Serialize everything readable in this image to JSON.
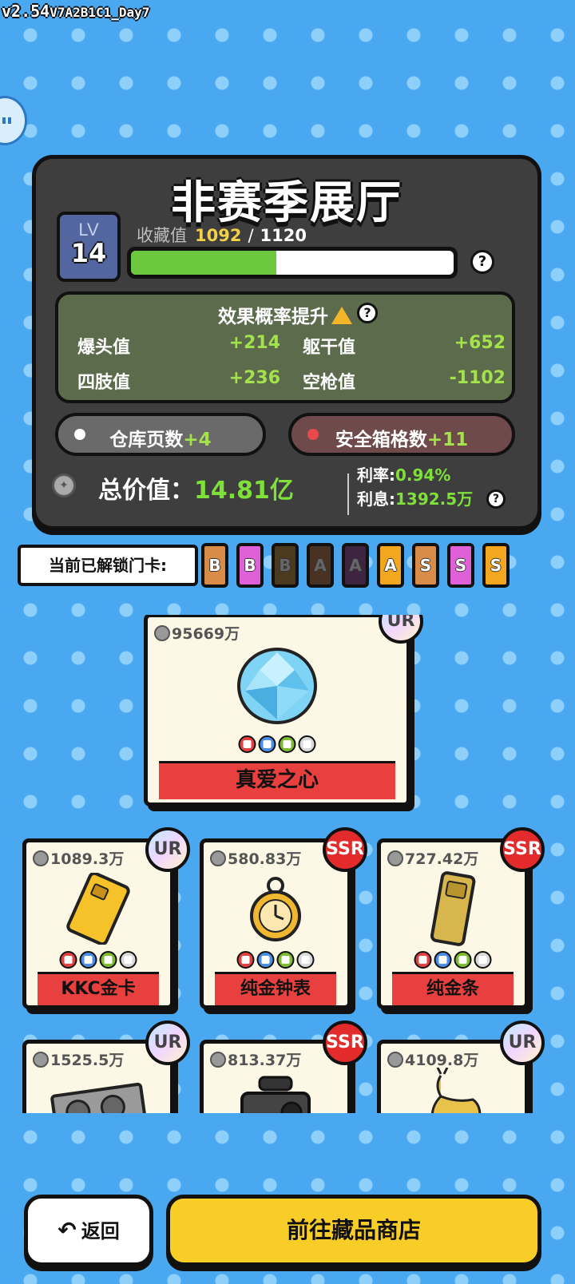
{
  "version": {
    "main": "v2.54",
    "build": "V7A2B1C1_Day7"
  },
  "hall": {
    "title": "非赛季展厅",
    "lv_label": "LV",
    "level": "14",
    "collect_label": "收藏值",
    "collect_current": "1092",
    "collect_sep": "/",
    "collect_max": "1120",
    "collect_progress": 0.45
  },
  "effects": {
    "title": "效果概率提升",
    "stats": [
      {
        "label": "爆头值",
        "value": "+214"
      },
      {
        "label": "躯干值",
        "value": "+652"
      },
      {
        "label": "四肢值",
        "value": "+236"
      },
      {
        "label": "空枪值",
        "value": "-1102"
      }
    ]
  },
  "pills": {
    "warehouse_label": "仓库页数",
    "warehouse_plus": "+4",
    "safebox_label": "安全箱格数",
    "safebox_plus": "+11"
  },
  "total": {
    "label": "总价值：",
    "value": "14.81亿",
    "rate_label": "利率:",
    "rate_value": "0.94%",
    "interest_label": "利息:",
    "interest_value": "1392.5万"
  },
  "keycards": {
    "label": "当前已解锁门卡:",
    "cards": [
      {
        "letter": "B",
        "color": "#d98c48",
        "dim": false
      },
      {
        "letter": "B",
        "color": "#e060d8",
        "dim": false
      },
      {
        "letter": "B",
        "color": "#4a3a1e",
        "dim": true
      },
      {
        "letter": "A",
        "color": "#4a3222",
        "dim": true
      },
      {
        "letter": "A",
        "color": "#3e2440",
        "dim": true
      },
      {
        "letter": "A",
        "color": "#f2a71e",
        "dim": false
      },
      {
        "letter": "S",
        "color": "#d98c48",
        "dim": false
      },
      {
        "letter": "S",
        "color": "#e060d8",
        "dim": false
      },
      {
        "letter": "S",
        "color": "#f2a71e",
        "dim": false
      }
    ]
  },
  "featured": {
    "price": "95669万",
    "rarity": "UR",
    "name": "真爱之心"
  },
  "items": [
    {
      "price": "1089.3万",
      "rarity": "UR",
      "name": "KKC金卡"
    },
    {
      "price": "580.83万",
      "rarity": "SSR",
      "name": "纯金钟表"
    },
    {
      "price": "727.42万",
      "rarity": "SSR",
      "name": "纯金条"
    },
    {
      "price": "1525.5万",
      "rarity": "UR",
      "name": ""
    },
    {
      "price": "813.37万",
      "rarity": "SSR",
      "name": ""
    },
    {
      "price": "4109.8万",
      "rarity": "UR",
      "name": ""
    }
  ],
  "buttons": {
    "back": "返回",
    "shop": "前往藏品商店"
  }
}
